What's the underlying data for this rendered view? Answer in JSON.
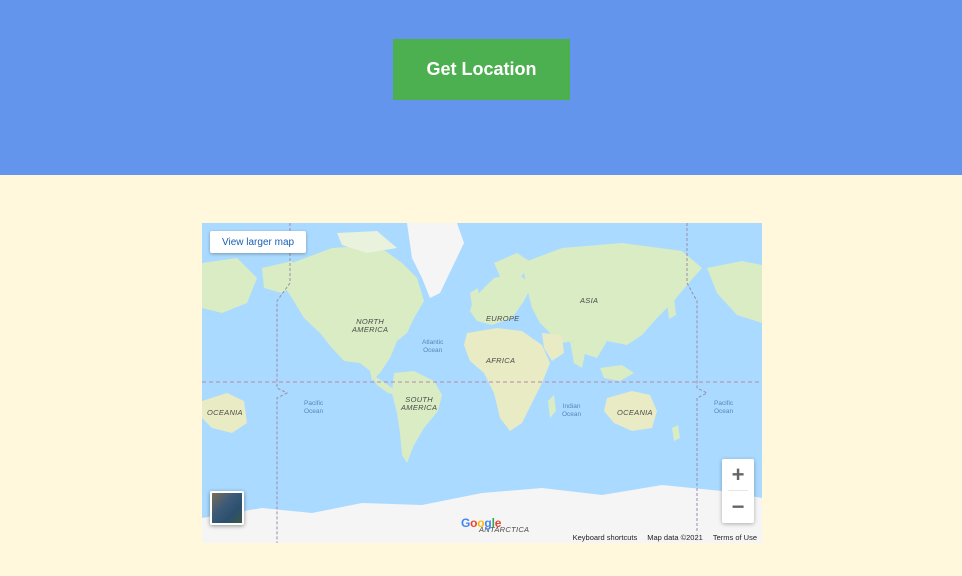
{
  "header": {
    "button_label": "Get Location",
    "background_color": "#6495ed",
    "button_color": "#4caf50"
  },
  "content": {
    "background_color": "#fff8dc"
  },
  "map": {
    "view_larger_label": "View larger map",
    "zoom_in_label": "+",
    "zoom_out_label": "−",
    "labels": {
      "north_america": [
        "NORTH",
        "AMERICA"
      ],
      "south_america": [
        "SOUTH",
        "AMERICA"
      ],
      "europe": "EUROPE",
      "asia": "ASIA",
      "africa": "AFRICA",
      "oceania_left": "OCEANIA",
      "oceania_right": "OCEANIA",
      "antarctica": "ANTARCTICA",
      "atlantic": [
        "Atlantic",
        "Ocean"
      ],
      "pacific_left": [
        "Pacific",
        "Ocean"
      ],
      "pacific_right": [
        "Pacific",
        "Ocean"
      ],
      "indian": [
        "Indian",
        "Ocean"
      ]
    },
    "logo": [
      "G",
      "o",
      "o",
      "g",
      "l",
      "e"
    ],
    "footer": {
      "keyboard": "Keyboard shortcuts",
      "map_data": "Map data ©2021",
      "terms": "Terms of Use"
    },
    "colors": {
      "water": "#aadaff",
      "land": "#d9ecc4",
      "ice": "#f5f5f5"
    }
  }
}
